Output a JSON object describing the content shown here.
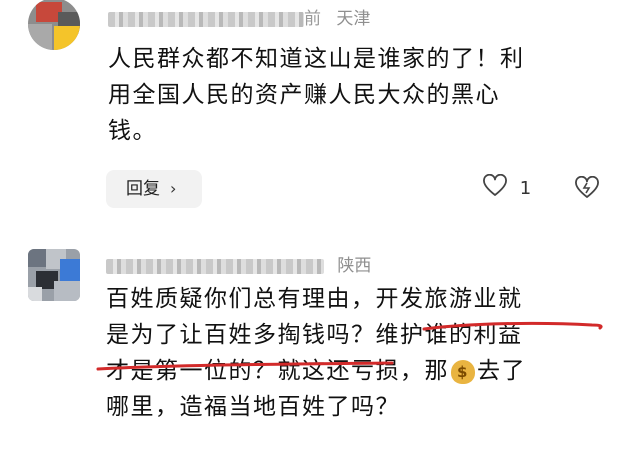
{
  "comments": [
    {
      "location": "天津",
      "time_suffix": "前",
      "lines": [
        "人民群众都不知道这山是谁家的了！利",
        "用全国人民的资产赚人民大众的黑心",
        "钱。"
      ],
      "reply_label": "回复",
      "like_count": "1"
    },
    {
      "location": "陕西",
      "lines": [
        "百姓质疑你们总有理由，开发旅游业就",
        "是为了让百姓多掏钱吗？维护谁的利益",
        "才是第一位的？就这还亏损，那",
        "去了",
        "哪里，造福当地百姓了吗？"
      ]
    }
  ],
  "colors": {
    "highlight": "#d22a2a",
    "meta_text": "#9a9a9a"
  },
  "icons": [
    "chevron-right-icon",
    "heart-outline-icon",
    "report-icon",
    "money-bag-emoji"
  ]
}
